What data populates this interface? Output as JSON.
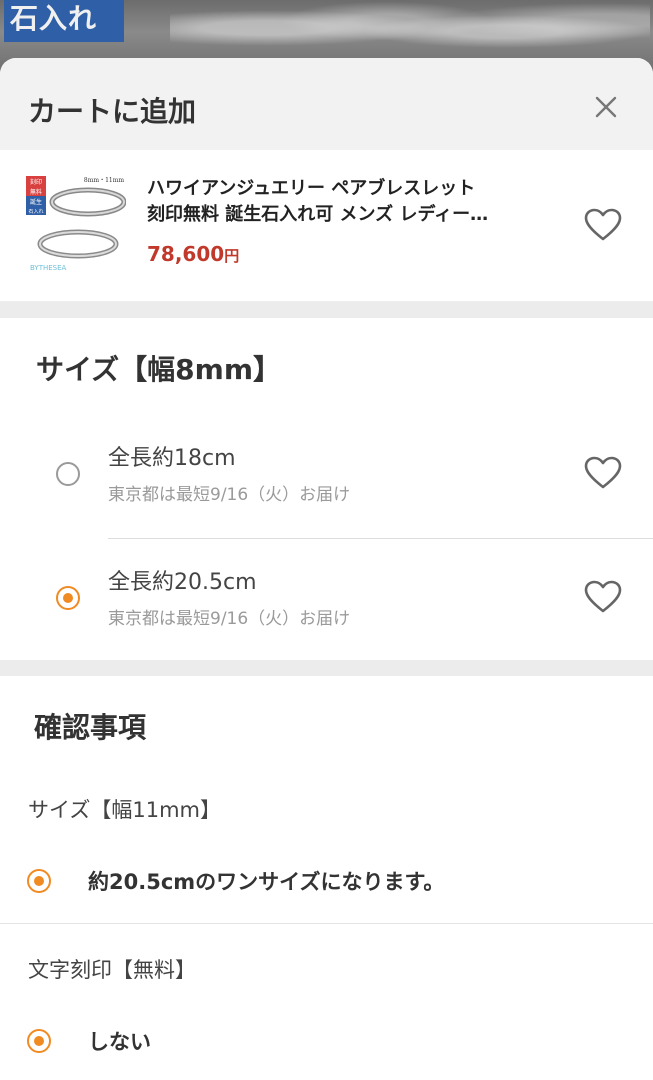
{
  "backdrop": {
    "tag_text": "石入れ"
  },
  "sheet": {
    "title": "カートに追加",
    "close_label": "×"
  },
  "product": {
    "name_line1": "ハワイアンジュエリー ペアブレスレット",
    "name_line2": "刻印無料 誕生石入れ可 メンズ レディー…",
    "price_number": "78,600",
    "price_unit": "円",
    "thumb_badge_1": "刻印",
    "thumb_badge_2": "無料",
    "thumb_badge_3": "誕生",
    "thumb_badge_4": "石入れ",
    "thumb_caption": "8mm・11mm",
    "thumb_brand": "BYTHESEA"
  },
  "size_section": {
    "title": "サイズ【幅8mm】",
    "options": [
      {
        "label": "全長約18cm",
        "delivery": "東京都は最短9/16（火）お届け",
        "selected": false
      },
      {
        "label": "全長約20.5cm",
        "delivery": "東京都は最短9/16（火）お届け",
        "selected": true
      }
    ]
  },
  "confirm_section": {
    "title": "確認事項",
    "items": [
      {
        "label": "サイズ【幅11mm】",
        "choice": "約20.5cmのワンサイズになります。"
      },
      {
        "label": "文字刻印【無料】",
        "choice": "しない"
      }
    ]
  },
  "colors": {
    "accent": "#f08a22",
    "price": "#c0392b"
  }
}
